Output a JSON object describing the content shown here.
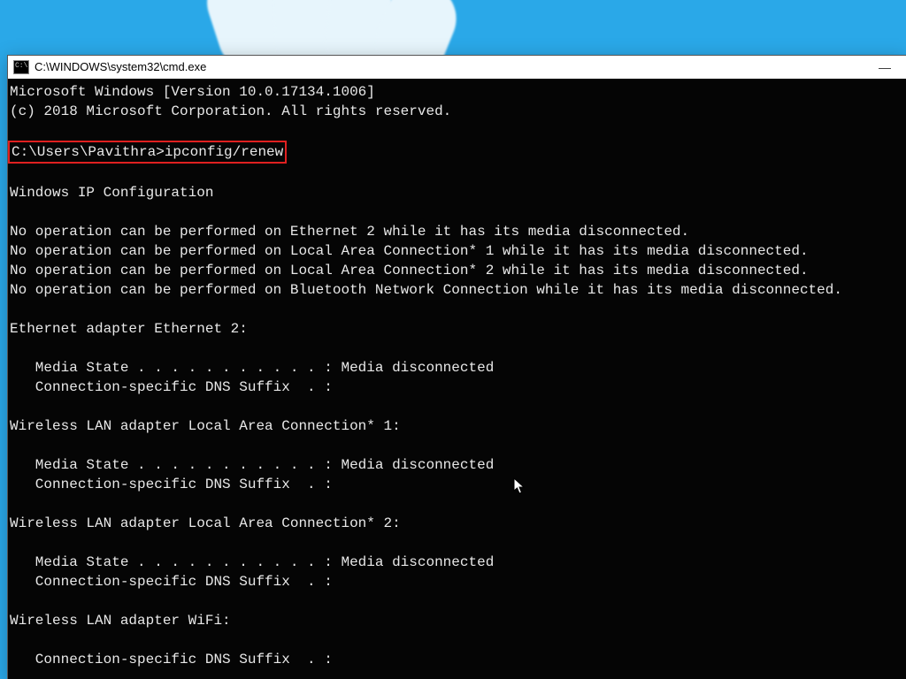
{
  "window": {
    "title": "C:\\WINDOWS\\system32\\cmd.exe",
    "min_label": "—"
  },
  "terminal": {
    "header1": "Microsoft Windows [Version 10.0.17134.1006]",
    "header2": "(c) 2018 Microsoft Corporation. All rights reserved.",
    "prompt_line": "C:\\Users\\Pavithra>ipconfig/renew",
    "section_title": "Windows IP Configuration",
    "no_ops": [
      "No operation can be performed on Ethernet 2 while it has its media disconnected.",
      "No operation can be performed on Local Area Connection* 1 while it has its media disconnected.",
      "No operation can be performed on Local Area Connection* 2 while it has its media disconnected.",
      "No operation can be performed on Bluetooth Network Connection while it has its media disconnected."
    ],
    "adapters": [
      {
        "title": "Ethernet adapter Ethernet 2:",
        "lines": [
          "   Media State . . . . . . . . . . . : Media disconnected",
          "   Connection-specific DNS Suffix  . :"
        ]
      },
      {
        "title": "Wireless LAN adapter Local Area Connection* 1:",
        "lines": [
          "   Media State . . . . . . . . . . . : Media disconnected",
          "   Connection-specific DNS Suffix  . :"
        ]
      },
      {
        "title": "Wireless LAN adapter Local Area Connection* 2:",
        "lines": [
          "   Media State . . . . . . . . . . . : Media disconnected",
          "   Connection-specific DNS Suffix  . :"
        ]
      },
      {
        "title": "Wireless LAN adapter WiFi:",
        "lines": [
          "   Connection-specific DNS Suffix  . :"
        ]
      }
    ]
  }
}
